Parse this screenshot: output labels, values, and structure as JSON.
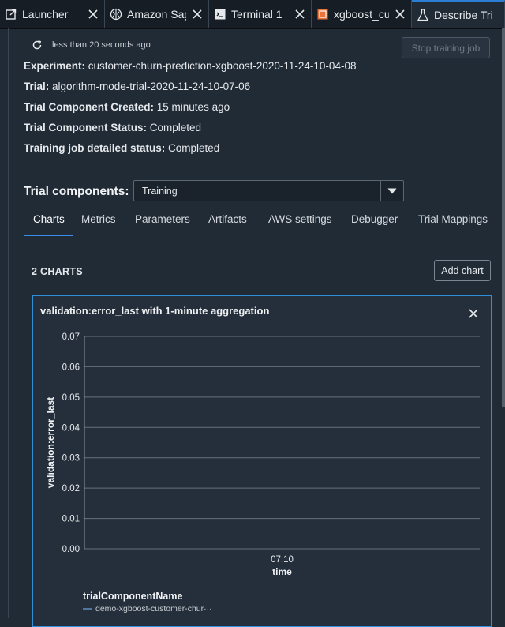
{
  "tabs": [
    {
      "label": "Launcher",
      "icon": "launch-icon",
      "active": false
    },
    {
      "label": "Amazon Sag",
      "icon": "brain-icon",
      "active": false
    },
    {
      "label": "Terminal 1",
      "icon": "terminal-icon",
      "active": false
    },
    {
      "label": "xgboost_cus",
      "icon": "notebook-icon",
      "active": false
    },
    {
      "label": "Describe Tri",
      "icon": "flask-icon",
      "active": true
    }
  ],
  "status": {
    "refresh_text": "less than 20 seconds ago",
    "stop_button": "Stop training job"
  },
  "details": [
    {
      "label": "Experiment:",
      "value": " customer-churn-prediction-xgboost-2020-11-24-10-04-08"
    },
    {
      "label": "Trial:",
      "value": " algorithm-mode-trial-2020-11-24-10-07-06"
    },
    {
      "label": "Trial Component Created:",
      "value": " 15 minutes ago"
    },
    {
      "label": "Trial Component Status:",
      "value": " Completed"
    },
    {
      "label": "Training job detailed status:",
      "value": " Completed"
    }
  ],
  "trial_components": {
    "label": "Trial components:",
    "selected": "Training"
  },
  "subtabs": [
    "Charts",
    "Metrics",
    "Parameters",
    "Artifacts",
    "AWS settings",
    "Debugger",
    "Trial Mappings"
  ],
  "charts_section": {
    "count_label": "2 CHARTS",
    "add_chart": "Add chart"
  },
  "colors": {
    "accent": "#2f8fd8",
    "background": "#202b36",
    "series": "#5f8fc0"
  },
  "chart_data": {
    "type": "line",
    "title": "validation:error_last with 1-minute aggregation",
    "xlabel": "time",
    "ylabel": "validation:error_last",
    "x_ticks": [
      "07:10"
    ],
    "y_ticks": [
      "0.00",
      "0.01",
      "0.02",
      "0.03",
      "0.04",
      "0.05",
      "0.06",
      "0.07"
    ],
    "ylim": [
      0,
      0.07
    ],
    "grid": true,
    "legend_title": "trialComponentName",
    "series": [
      {
        "name": "demo-xgboost-customer-chur···",
        "values": []
      }
    ]
  }
}
